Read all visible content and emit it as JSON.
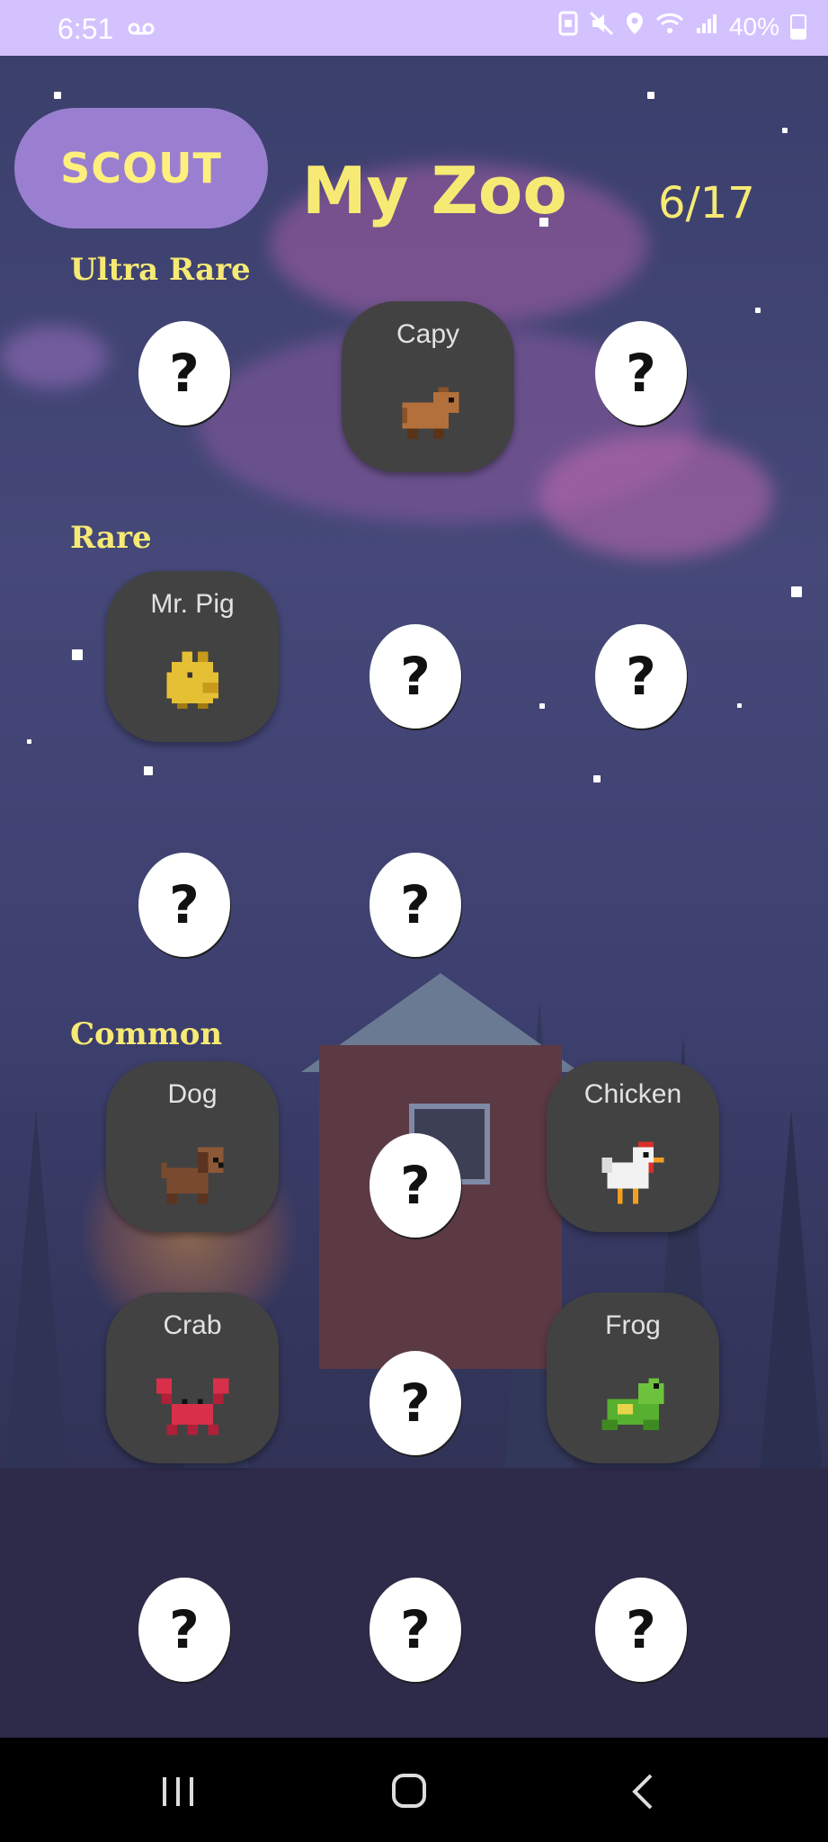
{
  "status_bar": {
    "time": "6:51",
    "voicemail_icon": "voicemail-icon",
    "battery": "40%"
  },
  "header": {
    "scout_label": "SCOUT",
    "title": "My Zoo",
    "counter": "6/17"
  },
  "sections": {
    "ultra_rare": "Ultra Rare",
    "rare": "Rare",
    "common": "Common"
  },
  "unknown_glyph": "?",
  "animals": {
    "capy": "Capy",
    "mr_pig": "Mr. Pig",
    "dog": "Dog",
    "chicken": "Chicken",
    "crab": "Crab",
    "frog": "Frog"
  },
  "colors": {
    "status_bar": "#d4c2ff",
    "accent_yellow": "#f7ea74",
    "scout_button": "#9a7fd0",
    "card_bg": "#424242"
  }
}
